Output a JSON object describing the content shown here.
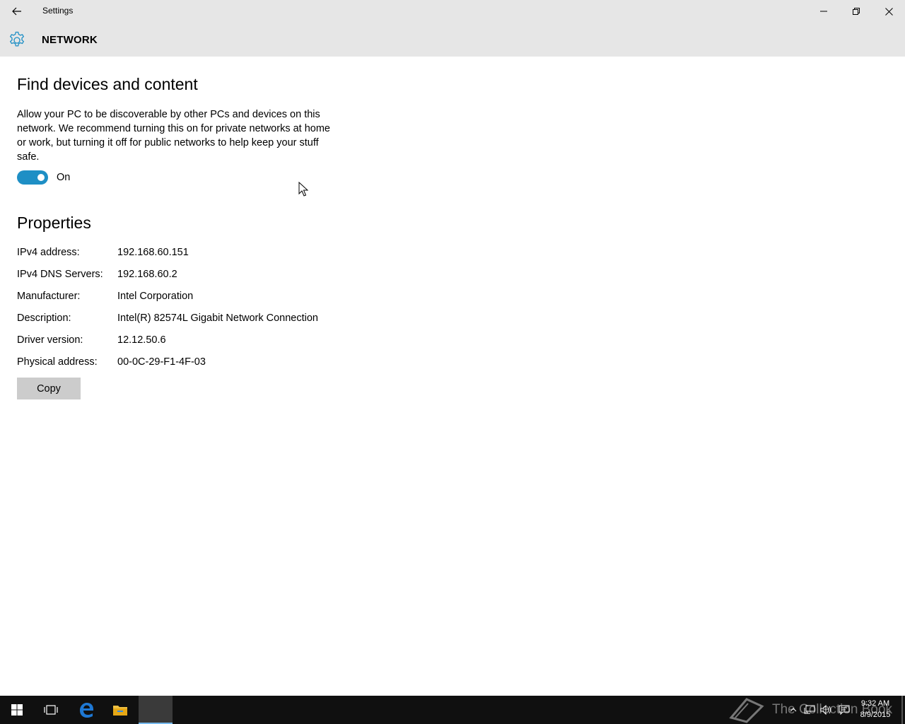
{
  "window": {
    "title": "Settings",
    "controls": {
      "minimize": "minimize-icon",
      "maximize": "restore-icon",
      "close": "close-icon"
    }
  },
  "header": {
    "icon": "gear-icon",
    "title": "NETWORK"
  },
  "find_devices": {
    "title": "Find devices and content",
    "description": "Allow your PC to be discoverable by other PCs and devices on this network. We recommend turning this on for private networks at home or work, but turning it off for public networks to help keep your stuff safe.",
    "toggle_state": "On",
    "toggle_on": true
  },
  "properties": {
    "title": "Properties",
    "rows": [
      {
        "label": "IPv4 address:",
        "value": "192.168.60.151"
      },
      {
        "label": "IPv4 DNS Servers:",
        "value": "192.168.60.2"
      },
      {
        "label": "Manufacturer:",
        "value": "Intel Corporation"
      },
      {
        "label": "Description:",
        "value": "Intel(R) 82574L Gigabit Network Connection"
      },
      {
        "label": "Driver version:",
        "value": "12.12.50.6"
      },
      {
        "label": "Physical address:",
        "value": "00-0C-29-F1-4F-03"
      }
    ],
    "copy_label": "Copy"
  },
  "taskbar": {
    "watermark": "The Collection Book",
    "clock_time": "9:32 AM",
    "clock_date": "8/9/2015"
  },
  "colors": {
    "accent": "#1e8fc5",
    "chrome": "#e6e6e6",
    "taskbar": "#101010"
  }
}
